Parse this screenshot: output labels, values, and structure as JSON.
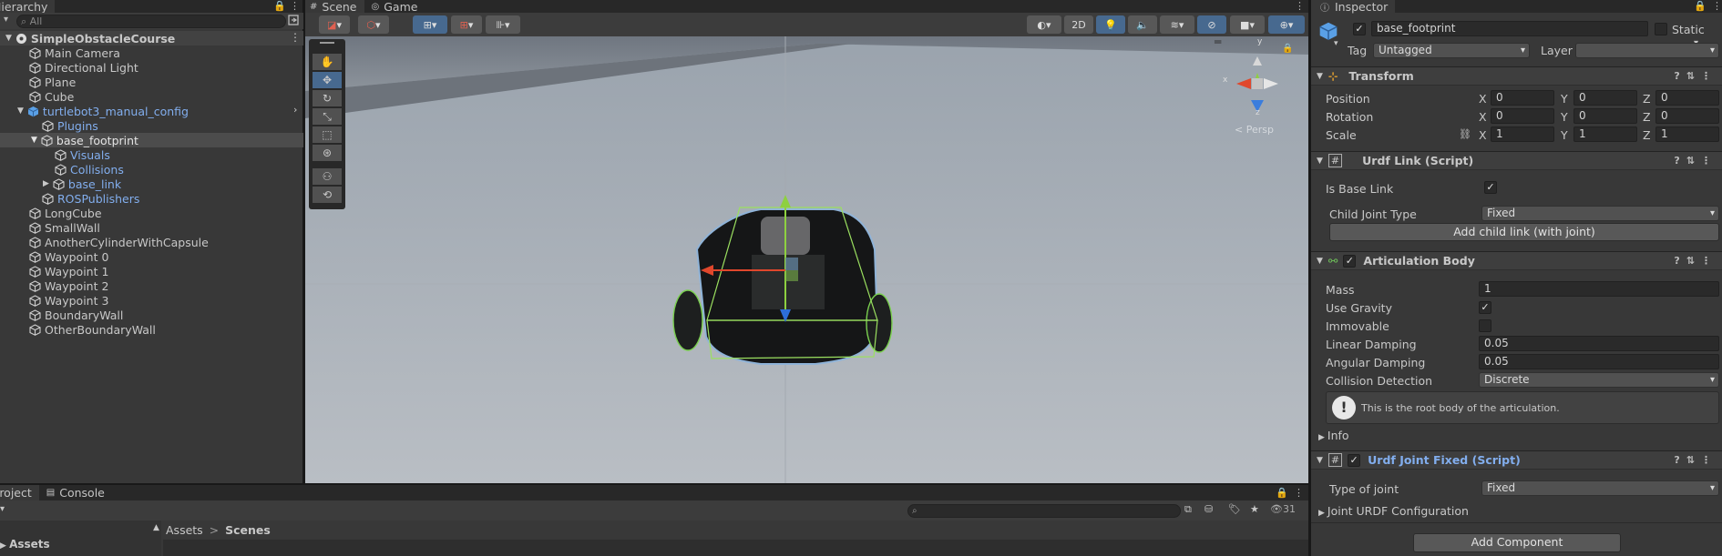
{
  "hierarchy": {
    "tab_label": "Hierarchy",
    "search_placeholder": "All",
    "scene_name": "SimpleObstacleCourse",
    "items": [
      {
        "label": "Main Camera"
      },
      {
        "label": "Directional Light"
      },
      {
        "label": "Plane"
      },
      {
        "label": "Cube"
      },
      {
        "label": "turtlebot3_manual_config"
      },
      {
        "label": "Plugins"
      },
      {
        "label": "base_footprint"
      },
      {
        "label": "Visuals"
      },
      {
        "label": "Collisions"
      },
      {
        "label": "base_link"
      },
      {
        "label": "ROSPublishers"
      },
      {
        "label": "LongCube"
      },
      {
        "label": "SmallWall"
      },
      {
        "label": "AnotherCylinderWithCapsule"
      },
      {
        "label": "Waypoint 0"
      },
      {
        "label": "Waypoint 1"
      },
      {
        "label": "Waypoint 2"
      },
      {
        "label": "Waypoint 3"
      },
      {
        "label": "BoundaryWall"
      },
      {
        "label": "OtherBoundaryWall"
      }
    ]
  },
  "scene": {
    "tab_scene": "Scene",
    "tab_game": "Game",
    "mode_2d": "2D",
    "gizmo": {
      "y": "y",
      "x": "x",
      "z": "z",
      "persp": "< Persp"
    }
  },
  "project": {
    "tab_project": "Project",
    "tab_console": "Console",
    "count": "31",
    "crumb_assets": "Assets",
    "crumb_sep": ">",
    "crumb_scenes": "Scenes",
    "tree_assets": "Assets"
  },
  "inspector": {
    "tab_label": "Inspector",
    "object_name": "base_footprint",
    "static_label": "Static",
    "tag_label": "Tag",
    "tag_value": "Untagged",
    "layer_label": "Layer",
    "layer_value": "",
    "transform": {
      "title": "Transform",
      "position_label": "Position",
      "rotation_label": "Rotation",
      "scale_label": "Scale",
      "x": "X",
      "y": "Y",
      "z": "Z",
      "position": [
        "0",
        "0",
        "0"
      ],
      "rotation": [
        "0",
        "0",
        "0"
      ],
      "scale": [
        "1",
        "1",
        "1"
      ]
    },
    "urdf_link": {
      "title": "Urdf Link (Script)",
      "is_base_label": "Is Base Link",
      "child_joint_label": "Child Joint Type",
      "child_joint_value": "Fixed",
      "add_child_button": "Add child link (with joint)"
    },
    "articulation": {
      "title": "Articulation Body",
      "mass_label": "Mass",
      "mass": "1",
      "use_gravity_label": "Use Gravity",
      "immovable_label": "Immovable",
      "linear_damping_label": "Linear Damping",
      "linear_damping": "0.05",
      "angular_damping_label": "Angular Damping",
      "angular_damping": "0.05",
      "collision_label": "Collision Detection",
      "collision_value": "Discrete",
      "info_text": "This is the root body of the articulation.",
      "info_foldout": "Info"
    },
    "joint_fixed": {
      "title": "Urdf Joint Fixed (Script)",
      "type_label": "Type of joint",
      "type_value": "Fixed",
      "config_foldout": "Joint URDF Configuration"
    },
    "add_component_button": "Add Component"
  },
  "colors": {
    "selection": "#4c4c4c",
    "accent": "#47698f",
    "prefab_blue": "#82aeee"
  }
}
